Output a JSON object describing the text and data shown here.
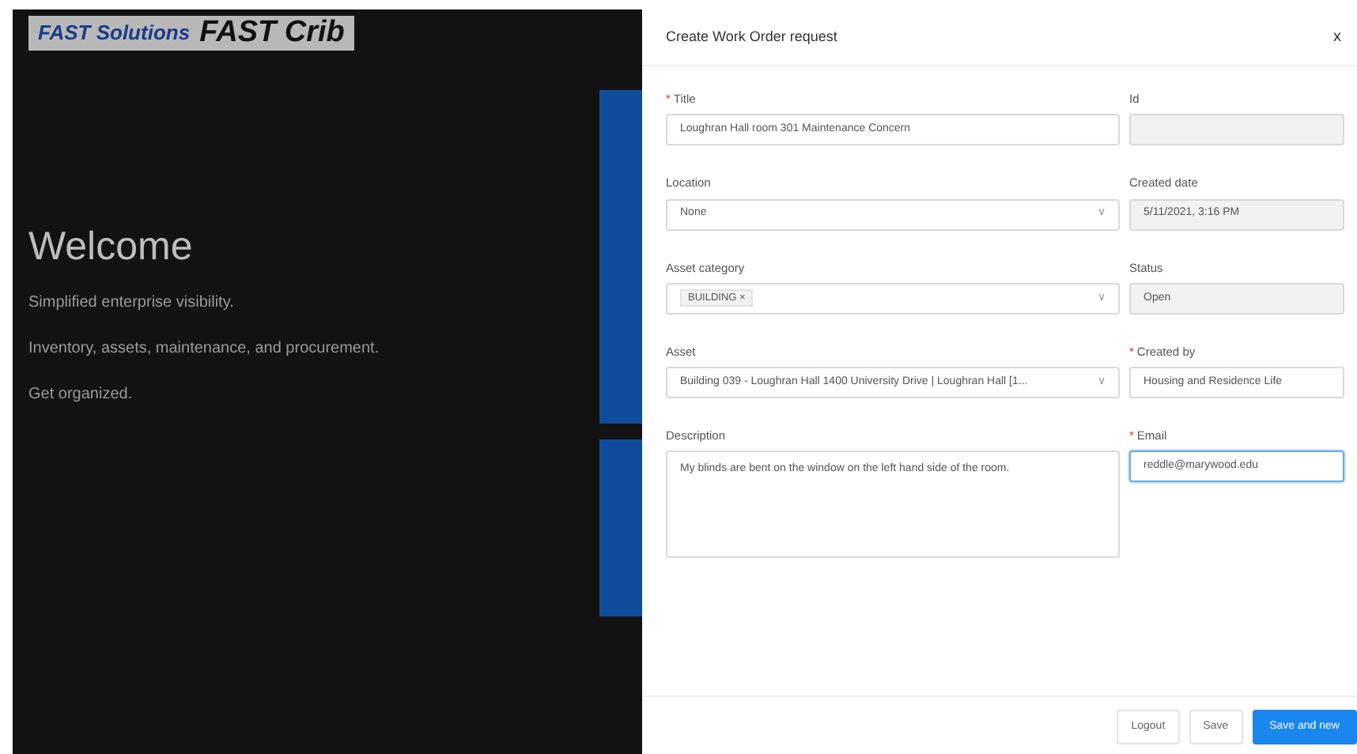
{
  "background": {
    "logo": {
      "brand": "FAST Solutions",
      "product": "FAST Crib"
    },
    "heading": "Welcome",
    "lines": [
      "Simplified enterprise visibility.",
      "Inventory, assets, maintenance, and procurement.",
      "Get organized."
    ]
  },
  "modal": {
    "title": "Create Work Order request",
    "close": "x",
    "fields": [
      {
        "label": "Title",
        "required_mark": "*",
        "kind": "input",
        "value": "Loughran Hall room 301 Maintenance Concern",
        "disabled": false,
        "focused": false
      },
      {
        "label": "Id",
        "kind": "input",
        "disabled": true,
        "focused": false
      },
      {
        "label": "Location",
        "kind": "select",
        "value": "None",
        "caret": "∨",
        "disabled": false,
        "focused": false
      },
      {
        "label": "Created date",
        "kind": "input",
        "value": "5/11/2021, 3:16 PM",
        "disabled": true,
        "focused": false
      },
      {
        "label": "Asset category",
        "kind": "tags",
        "tags": [
          {
            "label": "BUILDING",
            "remove": "×"
          }
        ],
        "caret": "∨",
        "disabled": false,
        "focused": false
      },
      {
        "label": "Status",
        "kind": "input",
        "value": "Open",
        "disabled": true,
        "focused": false
      },
      {
        "label": "Asset",
        "kind": "select",
        "value": "Building 039 - Loughran Hall 1400 University Drive | Loughran Hall [1...",
        "caret": "∨",
        "disabled": false,
        "focused": false
      },
      {
        "label": "Created by",
        "required_mark": "*",
        "kind": "input",
        "value": "Housing and Residence Life",
        "disabled": false,
        "focused": false
      },
      {
        "label": "Description",
        "kind": "textarea",
        "value": "My blinds are bent on the window on the left hand side of the room.",
        "disabled": false,
        "focused": false
      },
      {
        "label": "Email",
        "required_mark": "*",
        "kind": "input",
        "value": "reddle@marywood.edu",
        "disabled": false,
        "focused": true
      }
    ],
    "buttons": [
      {
        "label": "Logout",
        "kind": "default"
      },
      {
        "label": "Save",
        "kind": "default"
      },
      {
        "label": "Save and new",
        "kind": "primary"
      }
    ]
  }
}
